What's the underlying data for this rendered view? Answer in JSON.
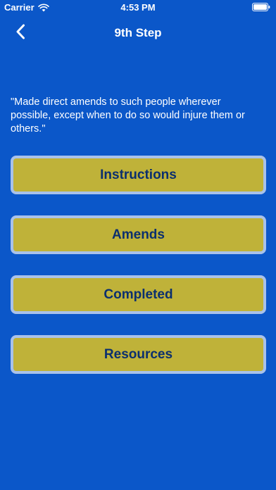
{
  "status_bar": {
    "carrier": "Carrier",
    "time": "4:53 PM",
    "wifi_icon": "wifi-icon",
    "battery_icon": "battery-full-icon"
  },
  "nav": {
    "title": "9th Step",
    "back_icon": "chevron-left-icon"
  },
  "quote": "\"Made direct amends to such people wherever possible, except when to do so would injure them or others.\"",
  "buttons": [
    {
      "label": "Instructions"
    },
    {
      "label": "Amends"
    },
    {
      "label": "Completed"
    },
    {
      "label": "Resources"
    }
  ],
  "colors": {
    "background": "#0b57c9",
    "button_fill": "#bfb239",
    "button_border": "#a9c2ea",
    "button_text": "#0b2f6e",
    "text": "#ffffff"
  }
}
